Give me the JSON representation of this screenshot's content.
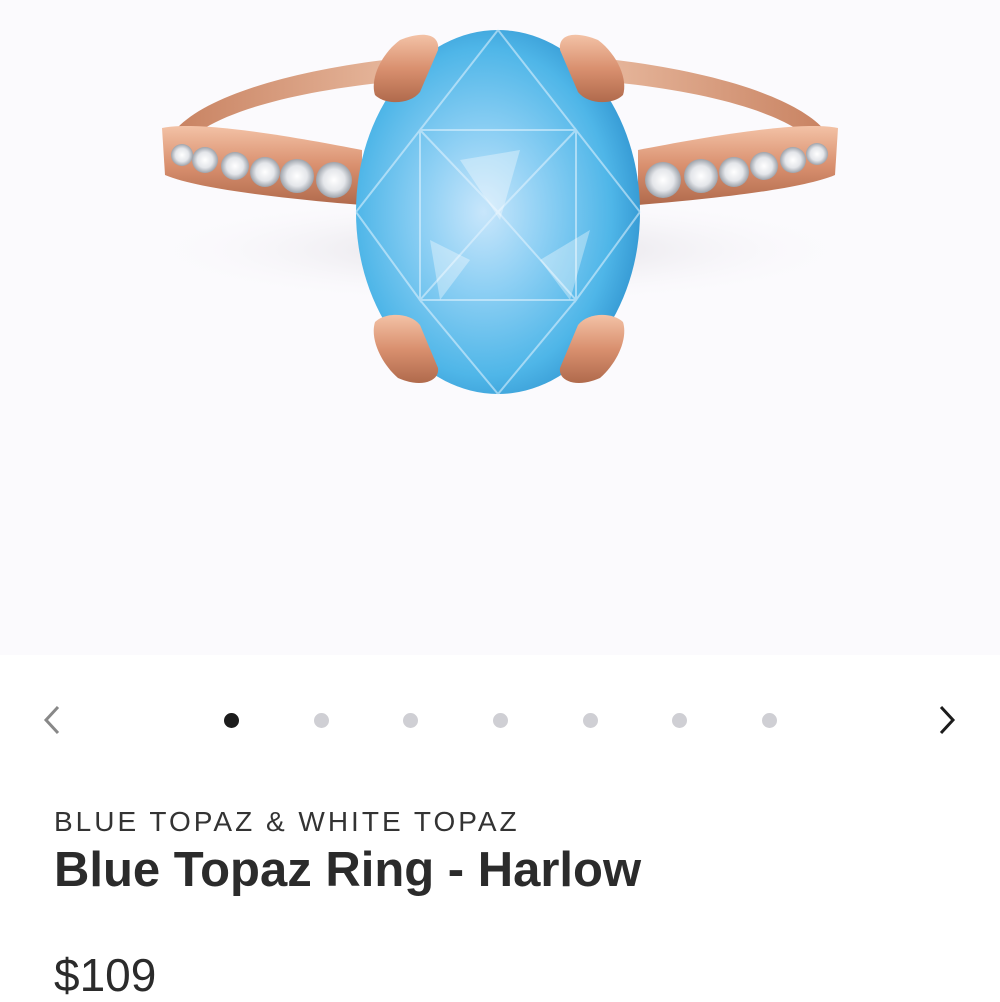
{
  "product": {
    "image_alt": "Blue topaz oval ring in rose gold with white topaz pave band",
    "eyebrow": "BLUE TOPAZ & WHITE TOPAZ",
    "title": "Blue Topaz Ring - Harlow",
    "price": "$109"
  },
  "carousel": {
    "total_slides": 7,
    "active_index": 0,
    "prev_icon": "chevron-left-icon",
    "next_icon": "chevron-right-icon"
  },
  "colors": {
    "hero_background": "#fbfafd",
    "gem_blue": "#5cc0ee",
    "rose_gold": "#d9906f",
    "active_dot": "#1c1c1c",
    "inactive_dot": "#cfcfd4",
    "text": "#2b2b2b"
  }
}
